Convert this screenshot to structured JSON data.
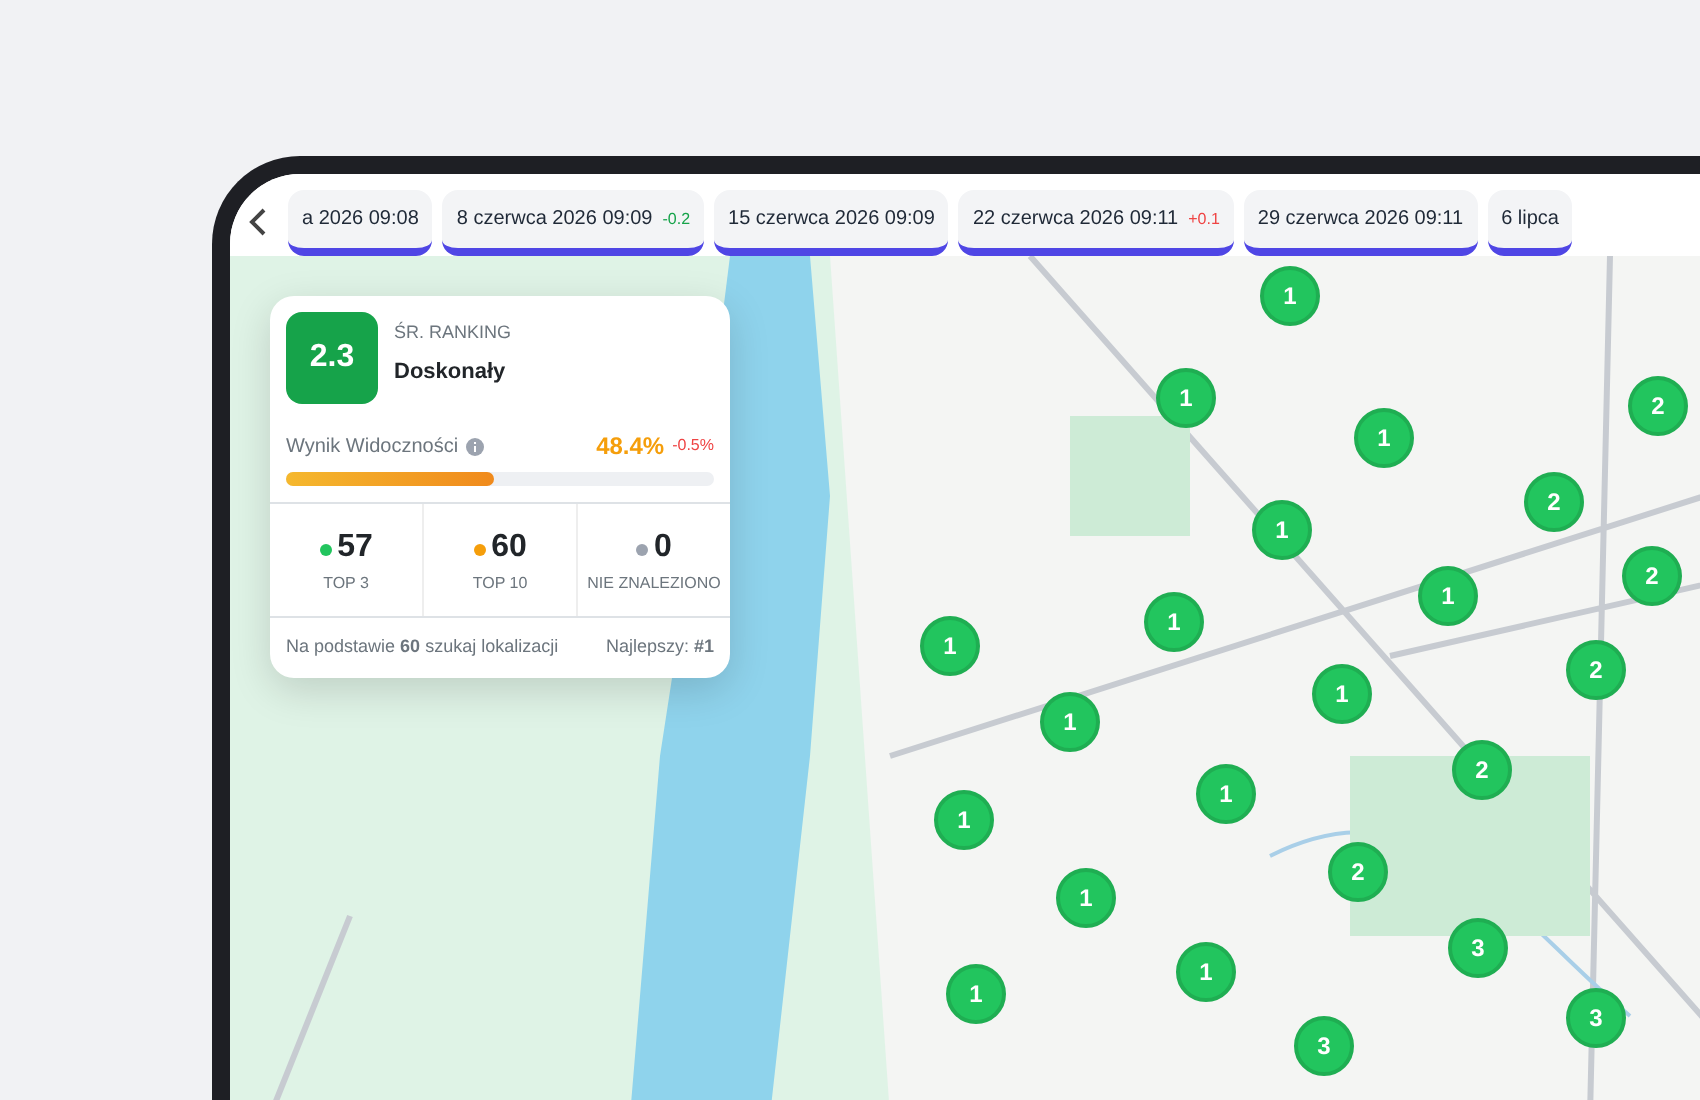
{
  "timeline": {
    "items": [
      {
        "label": "a 2026 09:08"
      },
      {
        "label": "8 czerwca 2026 09:09",
        "change": "-0.2",
        "color": "#16a34a"
      },
      {
        "label": "15 czerwca 2026 09:09"
      },
      {
        "label": "22 czerwca 2026 09:11",
        "change": "+0.1",
        "color": "#ef4444"
      },
      {
        "label": "29 czerwca 2026 09:11"
      },
      {
        "label": "6 lipca"
      }
    ]
  },
  "summary": {
    "score": "2.3",
    "caption": "ŚR. RANKING",
    "rating": "Doskonały",
    "visibility": {
      "label": "Wynik Widoczności",
      "value": "48.4%",
      "change": "-0.5%",
      "level": 0.484
    },
    "stats": [
      {
        "value": "57",
        "label": "TOP 3",
        "color": "#22c55e"
      },
      {
        "value": "60",
        "label": "TOP 10",
        "color": "#f59e0b"
      },
      {
        "value": "0",
        "label": "NIE ZNALEZIONO",
        "color": "#9ca3af"
      }
    ],
    "footer": "Na podstawie **60** szukaj lokalizacji",
    "best": "Najlepszy: **#1**"
  },
  "map": {
    "pins": [
      "1",
      "1",
      "1",
      "2",
      "2",
      "1",
      "2",
      "1",
      "1",
      "1",
      "2",
      "1",
      "1",
      "2",
      "1",
      "1",
      "2",
      "1",
      "3",
      "1",
      "1",
      "3",
      "3"
    ]
  }
}
